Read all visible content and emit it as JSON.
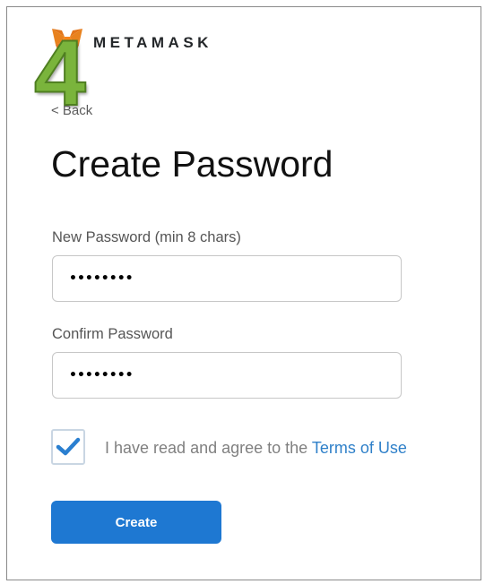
{
  "header": {
    "brand": "METAMASK",
    "logo_icon": "metamask-fox-icon",
    "step_badge": "4"
  },
  "nav": {
    "back_label": "< Back"
  },
  "page": {
    "title": "Create Password"
  },
  "form": {
    "new_password": {
      "label": "New Password (min 8 chars)",
      "value": "••••••••"
    },
    "confirm_password": {
      "label": "Confirm Password",
      "value": "••••••••"
    },
    "terms": {
      "checked": true,
      "text": "I have read and agree to the ",
      "link_text": "Terms of Use"
    },
    "submit_label": "Create"
  },
  "colors": {
    "accent": "#1e78d2",
    "link": "#2f80c9",
    "step_badge": "#7ab43c",
    "checkmark": "#2a7fd0"
  }
}
